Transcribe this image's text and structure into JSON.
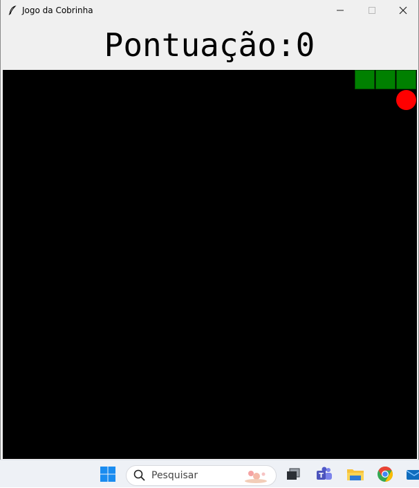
{
  "window": {
    "title": "Jogo da Cobrinha"
  },
  "score": {
    "label": "Pontuação:0",
    "value": 0
  },
  "game": {
    "background_color": "#000000",
    "snake_color": "#008000",
    "food_color": "#ff0000",
    "snake_length": 3,
    "food": {
      "shape": "circle"
    }
  },
  "taskbar": {
    "search_placeholder": "Pesquisar",
    "icons": [
      "windows-start-icon",
      "search-icon",
      "task-view-icon",
      "teams-icon",
      "file-explorer-icon",
      "chrome-icon",
      "mail-icon"
    ]
  }
}
